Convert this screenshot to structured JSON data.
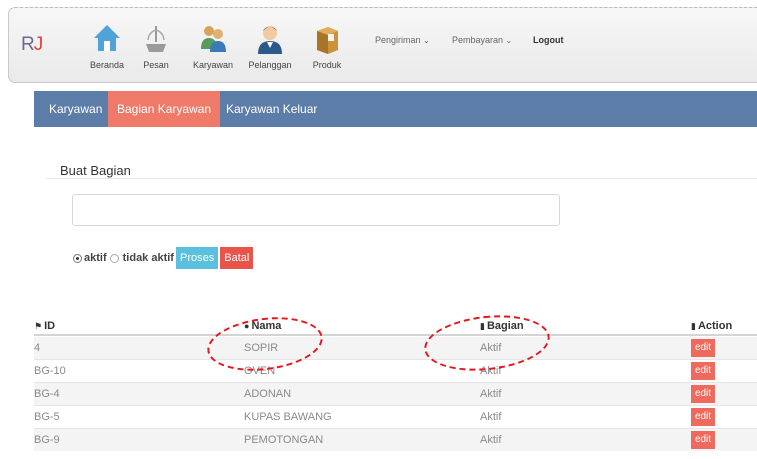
{
  "brand": {
    "text": "RJ",
    "r": "R",
    "j": "J"
  },
  "nav": {
    "items": [
      {
        "label": "Beranda",
        "icon": "home-icon"
      },
      {
        "label": "Pesan",
        "icon": "fountain-icon"
      },
      {
        "label": "Karyawan",
        "icon": "users-icon"
      },
      {
        "label": "Pelanggan",
        "icon": "customer-icon"
      },
      {
        "label": "Produk",
        "icon": "package-icon"
      }
    ],
    "dropdowns": [
      "Pengiriman",
      "Pembayaran"
    ],
    "logout": "Logout"
  },
  "tabs": [
    {
      "label": "Karyawan",
      "active": false
    },
    {
      "label": "Bagian Karyawan",
      "active": true
    },
    {
      "label": "Karyawan Keluar",
      "active": false
    }
  ],
  "form": {
    "title": "Buat Bagian",
    "input_value": "",
    "radio_aktif": "aktif",
    "radio_tidak": "tidak aktif",
    "proses": "Proses",
    "batal": "Batal"
  },
  "table": {
    "headers": [
      "ID",
      "Nama",
      "Bagian",
      "Action"
    ],
    "rows": [
      {
        "id": "4",
        "nama": "SOPIR",
        "bagian": "Aktif",
        "action": "edit"
      },
      {
        "id": "BG-10",
        "nama": "OVEN",
        "bagian": "Aktif",
        "action": "edit"
      },
      {
        "id": "BG-4",
        "nama": "ADONAN",
        "bagian": "Aktif",
        "action": "edit"
      },
      {
        "id": "BG-5",
        "nama": "KUPAS BAWANG",
        "bagian": "Aktif",
        "action": "edit"
      },
      {
        "id": "BG-9",
        "nama": "PEMOTONGAN",
        "bagian": "Aktif",
        "action": "edit"
      }
    ]
  },
  "colors": {
    "tabbar": "#5c7da8",
    "active_tab": "#f07a69",
    "proses": "#5bc0de",
    "batal": "#e8534a",
    "edit": "#ef6a5c",
    "annotation": "#e8141c"
  }
}
